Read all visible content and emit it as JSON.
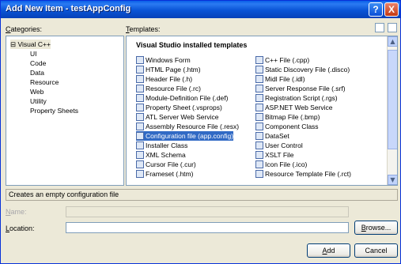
{
  "window": {
    "title": "Add New Item - testAppConfig",
    "help_label": "?",
    "close_label": "X"
  },
  "labels": {
    "categories_prefix": "C",
    "categories_rest": "ategories:",
    "templates_prefix": "T",
    "templates_rest": "emplates:"
  },
  "categories": [
    {
      "label": "Visual C++",
      "expander": "⊟",
      "level": 0
    },
    {
      "label": "UI",
      "level": 1
    },
    {
      "label": "Code",
      "level": 1
    },
    {
      "label": "Data",
      "level": 1
    },
    {
      "label": "Resource",
      "level": 1
    },
    {
      "label": "Web",
      "level": 1
    },
    {
      "label": "Utility",
      "level": 1
    },
    {
      "label": "Property Sheets",
      "level": 1
    }
  ],
  "templates": {
    "header": "Visual Studio installed templates",
    "left": [
      "Windows Form",
      "HTML Page (.htm)",
      "Header File (.h)",
      "Resource File (.rc)",
      "Module-Definition File (.def)",
      "Property Sheet (.vsprops)",
      "ATL Server Web Service",
      "Assembly Resource File (.resx)",
      "Configuration file (app.config)",
      "Installer Class",
      "XML Schema",
      "Cursor File (.cur)",
      "Frameset (.htm)"
    ],
    "right": [
      "C++ File (.cpp)",
      "Static Discovery File (.disco)",
      "Midl File (.idl)",
      "Server Response File (.srf)",
      "Registration Script (.rgs)",
      "ASP.NET Web Service",
      "Bitmap File (.bmp)",
      "Component Class",
      "DataSet",
      "User Control",
      "XSLT File",
      "Icon File (.ico)",
      "Resource Template File (.rct)"
    ],
    "selected": "Configuration file (app.config)"
  },
  "status_text": "Creates an empty configuration file",
  "form": {
    "name_prefix": "N",
    "name_rest": "ame:",
    "name_value": "",
    "location_prefix": "L",
    "location_rest": "ocation:",
    "location_value": "",
    "browse_prefix": "B",
    "browse_rest": "rowse..."
  },
  "buttons": {
    "add_prefix": "A",
    "add_rest": "dd",
    "cancel": "Cancel"
  },
  "colors": {
    "selection": "#316ac5",
    "titlebar": "#0a54d6"
  }
}
